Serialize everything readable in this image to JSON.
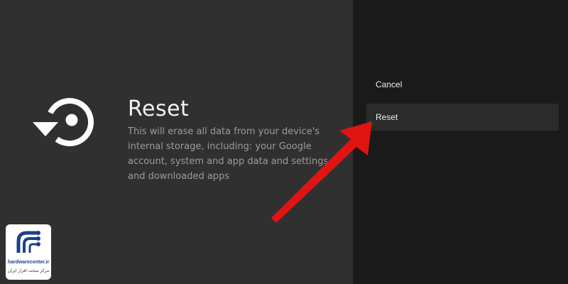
{
  "reset_screen": {
    "icon": "restore-icon",
    "title": "Reset",
    "description": "This will erase all data from your device's internal storage, including: your Google account, system and app data and settings and downloaded apps"
  },
  "menu": {
    "items": [
      {
        "label": "Cancel",
        "selected": false
      },
      {
        "label": "Reset",
        "selected": true
      }
    ]
  },
  "annotation": {
    "icon": "red-pointer-arrow",
    "color": "#e11414"
  },
  "watermark": {
    "icon": "hardwarecenter-logo",
    "brand_color": "#1d3f8f",
    "site": "hardwarecenter.ir",
    "tagline": "مرکز سخت افزار ایران"
  }
}
